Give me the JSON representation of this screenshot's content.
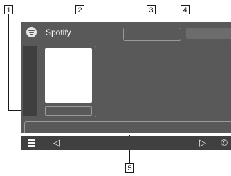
{
  "source": {
    "app_name": "Spotify"
  },
  "callouts": [
    "1",
    "2",
    "3",
    "4",
    "5"
  ],
  "navigation": {
    "back_glyph": "◁",
    "forward_glyph": "▷",
    "phone_glyph": "✆"
  },
  "icons": [
    "spotify-icon",
    "app-grid-icon",
    "back-icon",
    "forward-icon",
    "phone-icon"
  ],
  "colors": {
    "screen": "#595959",
    "bezel": "#404040",
    "sidebar": "#3f3f3f",
    "outline": "#9a9a9a"
  }
}
